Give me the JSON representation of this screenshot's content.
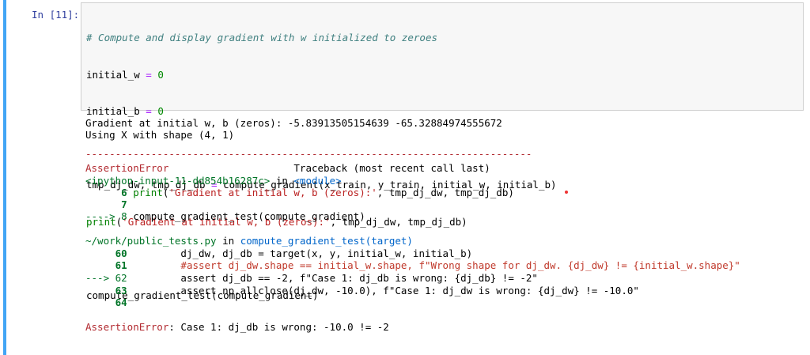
{
  "prompt_label": "In [11]:",
  "input_code": {
    "comment": "# Compute and display gradient with w initialized to zeroes",
    "line_w": [
      "initial_w",
      " = ",
      "0"
    ],
    "line_b": [
      "initial_b",
      " = ",
      "0"
    ],
    "line_grad": [
      "tmp_dj_dw, tmp_dj_db ",
      "=",
      " compute_gradient(x_train, y_train, initial_w, initial_b)"
    ],
    "line_print": [
      "print",
      "(",
      "'Gradient at initial w, b (zeros):'",
      ", tmp_dj_dw, tmp_dj_db)"
    ],
    "line_test": "compute_gradient_test(compute_gradient)"
  },
  "output": {
    "line1": "Gradient at initial w, b (zeros): -5.83913505154639 -65.32884974555672",
    "line2": "Using X with shape (4, 1)",
    "separator": "---------------------------------------------------------------------------",
    "err_name": "AssertionError",
    "traceback_header": "Traceback (most recent call last)",
    "ipython_input": "<ipython-input-11-dd854b16287c>",
    "in_word": " in ",
    "module": "<module>",
    "tb1_no": "      6 ",
    "tb1_code": [
      "print",
      "(",
      "'Gradient at initial w, b (zeros):'",
      ", tmp_dj_dw, tmp_dj_db)"
    ],
    "tb2_no": "      7",
    "tb3_arrow": "----> 8 ",
    "tb3_code": "compute_gradient_test(compute_gradient)",
    "file_path": "~/work/public_tests.py",
    "in_word2": " in ",
    "func": "compute_gradient_test(target)",
    "l60_no": "     60 ",
    "l60_code": "        dj_dw, dj_db = target(x, y, initial_w, initial_b)",
    "l61_no": "     61 ",
    "l61_code": "        #assert dj_dw.shape == initial_w.shape, f\"Wrong shape for dj_dw. {dj_dw} != {initial_w.shape}\"",
    "l62_arrow": "---> 62 ",
    "l62_code": "        assert dj_db == -2, f\"Case 1: dj_db is wrong: {dj_db} != -2\"",
    "l63_no": "     63 ",
    "l63_code": "        assert np.allclose(dj_dw, -10.0), f\"Case 1: dj_dw is wrong: {dj_dw} != -10.0\"",
    "l64_no": "     64",
    "final_err": "AssertionError",
    "final_msg": ": Case 1: dj_db is wrong: -10.0 != -2"
  }
}
